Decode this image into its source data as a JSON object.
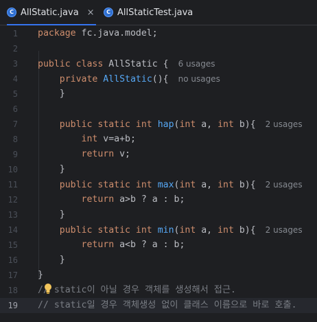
{
  "tabs": [
    {
      "label": "AllStatic.java",
      "icon": "java-class-icon",
      "active": true,
      "close": "×"
    },
    {
      "label": "AllStaticTest.java",
      "icon": "java-class-icon",
      "active": false
    }
  ],
  "icon_letter": "C",
  "colors": {
    "keyword": "#cf8e6d",
    "function": "#56a8f5",
    "comment": "#7a7e85",
    "text": "#bcbec4",
    "accent": "#3574f0"
  },
  "lines": [
    {
      "n": "1",
      "t": [
        {
          "k": "kw",
          "s": "package "
        },
        {
          "s": "fc.java.model;"
        }
      ]
    },
    {
      "n": "2",
      "t": []
    },
    {
      "n": "3",
      "t": [
        {
          "k": "kw",
          "s": "public class "
        },
        {
          "s": "AllStatic {"
        }
      ],
      "hint": "6 usages"
    },
    {
      "n": "4",
      "t": [
        {
          "s": "    "
        },
        {
          "k": "kw",
          "s": "private "
        },
        {
          "k": "fn",
          "s": "AllStatic"
        },
        {
          "s": "(){"
        }
      ],
      "hint": "no usages"
    },
    {
      "n": "5",
      "t": [
        {
          "s": "    }"
        }
      ]
    },
    {
      "n": "6",
      "t": []
    },
    {
      "n": "7",
      "t": [
        {
          "s": "    "
        },
        {
          "k": "kw",
          "s": "public static int "
        },
        {
          "k": "fn",
          "s": "hap"
        },
        {
          "s": "("
        },
        {
          "k": "kw",
          "s": "int "
        },
        {
          "s": "a, "
        },
        {
          "k": "kw",
          "s": "int "
        },
        {
          "s": "b){"
        }
      ],
      "hint": "2 usages"
    },
    {
      "n": "8",
      "t": [
        {
          "s": "        "
        },
        {
          "k": "kw",
          "s": "int "
        },
        {
          "s": "v=a+b;"
        }
      ]
    },
    {
      "n": "9",
      "t": [
        {
          "s": "        "
        },
        {
          "k": "kw",
          "s": "return "
        },
        {
          "s": "v;"
        }
      ]
    },
    {
      "n": "10",
      "t": [
        {
          "s": "    }"
        }
      ]
    },
    {
      "n": "11",
      "t": [
        {
          "s": "    "
        },
        {
          "k": "kw",
          "s": "public static int "
        },
        {
          "k": "fn",
          "s": "max"
        },
        {
          "s": "("
        },
        {
          "k": "kw",
          "s": "int "
        },
        {
          "s": "a, "
        },
        {
          "k": "kw",
          "s": "int "
        },
        {
          "s": "b){"
        }
      ],
      "hint": "2 usages"
    },
    {
      "n": "12",
      "t": [
        {
          "s": "        "
        },
        {
          "k": "kw",
          "s": "return "
        },
        {
          "s": "a>b ? a : b;"
        }
      ]
    },
    {
      "n": "13",
      "t": [
        {
          "s": "    }"
        }
      ]
    },
    {
      "n": "14",
      "t": [
        {
          "s": "    "
        },
        {
          "k": "kw",
          "s": "public static int "
        },
        {
          "k": "fn",
          "s": "min"
        },
        {
          "s": "("
        },
        {
          "k": "kw",
          "s": "int "
        },
        {
          "s": "a, "
        },
        {
          "k": "kw",
          "s": "int "
        },
        {
          "s": "b){"
        }
      ],
      "hint": "2 usages"
    },
    {
      "n": "15",
      "t": [
        {
          "s": "        "
        },
        {
          "k": "kw",
          "s": "return "
        },
        {
          "s": "a<b ? a : b;"
        }
      ]
    },
    {
      "n": "16",
      "t": [
        {
          "s": "    }"
        }
      ]
    },
    {
      "n": "17",
      "t": [
        {
          "s": "}"
        }
      ]
    },
    {
      "n": "18",
      "t": [
        {
          "k": "cm",
          "s": "// static이 아닐 경우 객체를 생성해서 접근."
        }
      ],
      "bulb": true
    },
    {
      "n": "19",
      "t": [
        {
          "k": "cm",
          "s": "// static일 경우 객체생성 없이 클래스 이름으로 바로 호출."
        }
      ],
      "current": true
    }
  ]
}
